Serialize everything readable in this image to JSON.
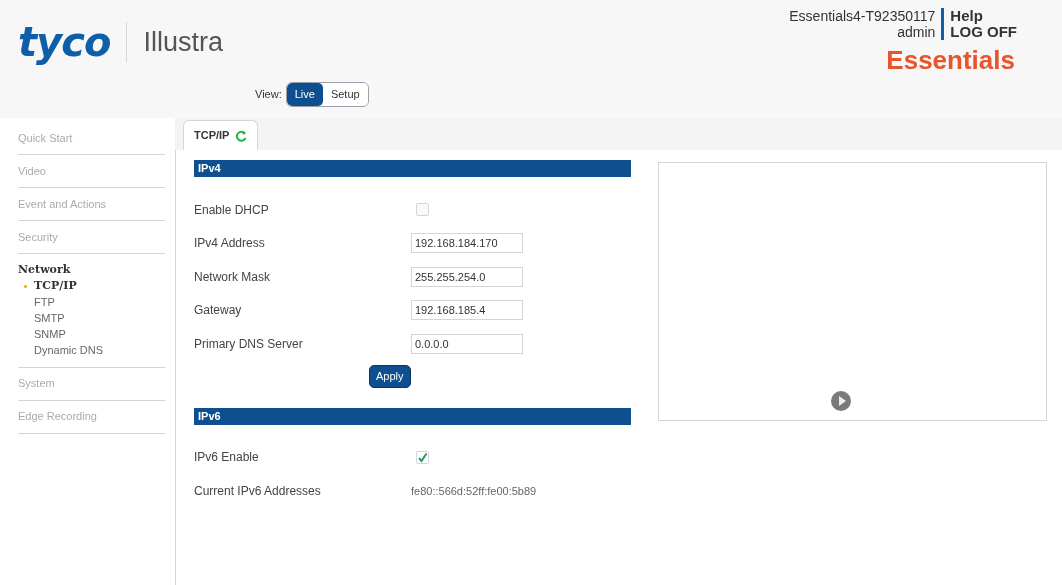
{
  "header": {
    "logo": "tyco",
    "product": "Illustra",
    "device": "Essentials4-T92350117",
    "user": "admin",
    "links": [
      "Help",
      "LOG OFF"
    ],
    "edition": "Essentials"
  },
  "view": {
    "label": "View:",
    "options": [
      {
        "label": "Live",
        "selected": true
      },
      {
        "label": "Setup",
        "selected": false
      }
    ]
  },
  "sidebar": {
    "items": [
      {
        "label": "Quick Start",
        "expanded": false
      },
      {
        "label": "Video",
        "expanded": false
      },
      {
        "label": "Event and Actions",
        "expanded": false
      },
      {
        "label": "Security",
        "expanded": false
      },
      {
        "label": "Network",
        "expanded": true,
        "children": [
          {
            "label": "TCP/IP",
            "selected": true
          },
          {
            "label": "FTP",
            "selected": false
          },
          {
            "label": "SMTP",
            "selected": false
          },
          {
            "label": "SNMP",
            "selected": false
          },
          {
            "label": "Dynamic DNS",
            "selected": false
          }
        ]
      },
      {
        "label": "System",
        "expanded": false
      },
      {
        "label": "Edge Recording",
        "expanded": false
      }
    ]
  },
  "tabs": [
    {
      "label": "TCP/IP",
      "selected": true
    }
  ],
  "sections": [
    {
      "title": "IPv4",
      "rows": [
        {
          "kind": "checkbox",
          "label": "Enable DHCP",
          "checked": false
        },
        {
          "kind": "input",
          "label": "IPv4 Address",
          "value": "192.168.184.170"
        },
        {
          "kind": "input",
          "label": "Network Mask",
          "value": "255.255.254.0"
        },
        {
          "kind": "input",
          "label": "Gateway",
          "value": "192.168.185.4"
        },
        {
          "kind": "input",
          "label": "Primary DNS Server",
          "value": "0.0.0.0"
        }
      ],
      "button": "Apply"
    },
    {
      "title": "IPv6",
      "rows": [
        {
          "kind": "checkbox",
          "label": "IPv6 Enable",
          "checked": true
        },
        {
          "kind": "text",
          "label": "Current IPv6 Addresses",
          "value": "fe80::566d:52ff:fe00:5b89"
        }
      ]
    }
  ]
}
